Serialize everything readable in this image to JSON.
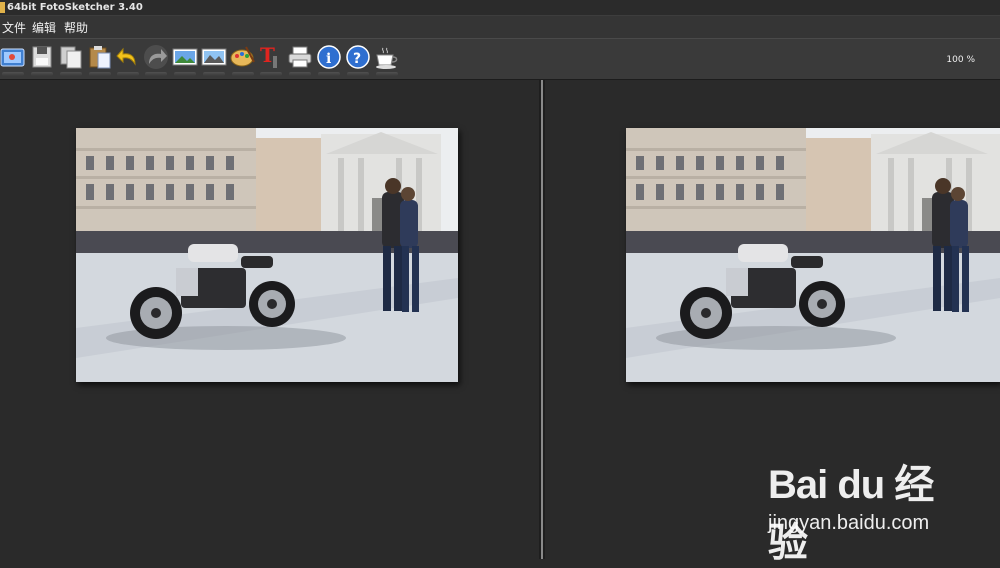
{
  "window": {
    "title": "64bit FotoSketcher 3.40"
  },
  "menu": {
    "items": [
      "文件",
      "编辑",
      "帮助"
    ]
  },
  "toolbar": {
    "zoom": "100 %"
  },
  "watermark": {
    "logo": "Bai du 经验",
    "url": "jingyan.baidu.com"
  },
  "colors": {
    "background": "#2a2a2a",
    "toolbar": "#3a3a3a",
    "menubar": "#353535"
  }
}
